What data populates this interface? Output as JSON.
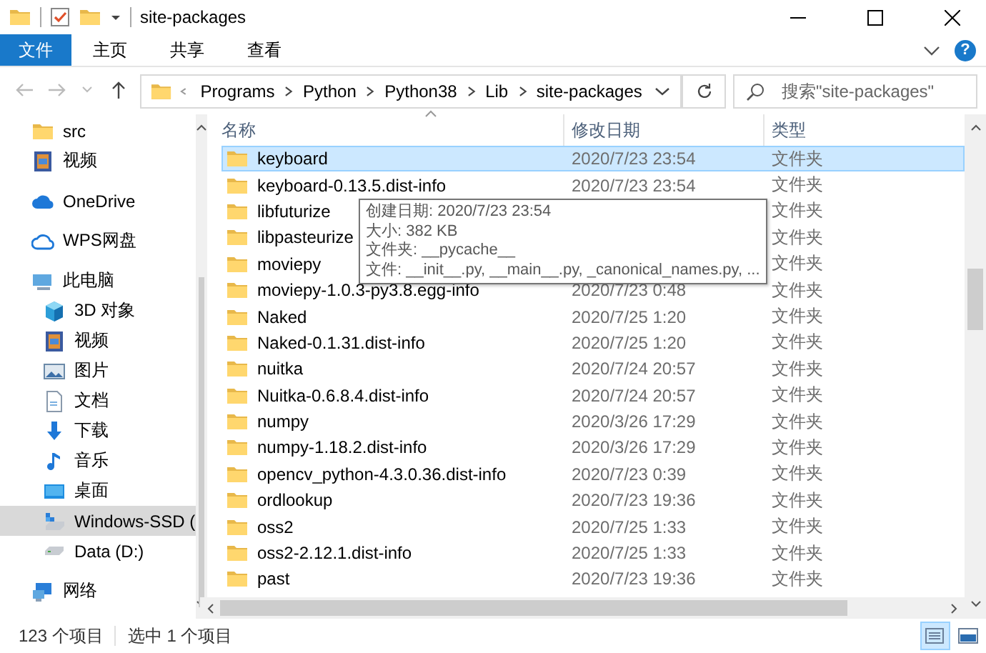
{
  "window": {
    "title": "site-packages"
  },
  "ribbon": {
    "file_button": "文件",
    "tabs": [
      {
        "label": "主页"
      },
      {
        "label": "共享"
      },
      {
        "label": "查看"
      }
    ],
    "help": "?"
  },
  "address": {
    "crumbs": [
      "Programs",
      "Python",
      "Python38",
      "Lib",
      "site-packages"
    ]
  },
  "search": {
    "placeholder": "搜索\"site-packages\""
  },
  "nav": {
    "items": [
      {
        "label": "src",
        "kind": "folder",
        "selected": false
      },
      {
        "label": "视频",
        "kind": "video",
        "selected": false
      },
      {
        "label": "OneDrive",
        "kind": "cloud",
        "selected": false
      },
      {
        "label": "WPS网盘",
        "kind": "cloud-outline",
        "selected": false
      },
      {
        "label": "此电脑",
        "kind": "pc",
        "selected": false,
        "children": [
          {
            "label": "3D 对象",
            "kind": "cube",
            "selected": false
          },
          {
            "label": "视频",
            "kind": "video",
            "selected": false
          },
          {
            "label": "图片",
            "kind": "picture",
            "selected": false
          },
          {
            "label": "文档",
            "kind": "document",
            "selected": false
          },
          {
            "label": "下载",
            "kind": "download",
            "selected": false
          },
          {
            "label": "音乐",
            "kind": "music",
            "selected": false
          },
          {
            "label": "桌面",
            "kind": "desktop",
            "selected": false
          },
          {
            "label": "Windows-SSD (",
            "kind": "system-drive",
            "selected": true
          },
          {
            "label": "Data (D:)",
            "kind": "drive",
            "selected": false
          }
        ]
      },
      {
        "label": "网络",
        "kind": "network",
        "selected": false
      }
    ]
  },
  "files": {
    "columns": [
      "名称",
      "修改日期",
      "类型"
    ],
    "rows": [
      {
        "name": "keyboard",
        "modified": "2020/7/23 23:54",
        "type": "文件夹",
        "selected": true
      },
      {
        "name": "keyboard-0.13.5.dist-info",
        "modified": "2020/7/23 23:54",
        "type": "文件夹",
        "selected": false
      },
      {
        "name": "libfuturize",
        "type": "文件夹",
        "selected": false
      },
      {
        "name": "libpasteurize",
        "type": "文件夹",
        "selected": false
      },
      {
        "name": "moviepy",
        "type": "文件夹",
        "selected": false
      },
      {
        "name": "moviepy-1.0.3-py3.8.egg-info",
        "modified": "2020/7/23 0:48",
        "type": "文件夹",
        "selected": false
      },
      {
        "name": "Naked",
        "modified": "2020/7/25 1:20",
        "type": "文件夹",
        "selected": false
      },
      {
        "name": "Naked-0.1.31.dist-info",
        "modified": "2020/7/25 1:20",
        "type": "文件夹",
        "selected": false
      },
      {
        "name": "nuitka",
        "modified": "2020/7/24 20:57",
        "type": "文件夹",
        "selected": false
      },
      {
        "name": "Nuitka-0.6.8.4.dist-info",
        "modified": "2020/7/24 20:57",
        "type": "文件夹",
        "selected": false
      },
      {
        "name": "numpy",
        "modified": "2020/3/26 17:29",
        "type": "文件夹",
        "selected": false
      },
      {
        "name": "numpy-1.18.2.dist-info",
        "modified": "2020/3/26 17:29",
        "type": "文件夹",
        "selected": false
      },
      {
        "name": "opencv_python-4.3.0.36.dist-info",
        "modified": "2020/7/23 0:39",
        "type": "文件夹",
        "selected": false
      },
      {
        "name": "ordlookup",
        "modified": "2020/7/23 19:36",
        "type": "文件夹",
        "selected": false
      },
      {
        "name": "oss2",
        "modified": "2020/7/25 1:33",
        "type": "文件夹",
        "selected": false
      },
      {
        "name": "oss2-2.12.1.dist-info",
        "modified": "2020/7/25 1:33",
        "type": "文件夹",
        "selected": false
      },
      {
        "name": "past",
        "modified": "2020/7/23 19:36",
        "type": "文件夹",
        "selected": false
      }
    ]
  },
  "tooltip": {
    "lines": [
      "创建日期: 2020/7/23 23:54",
      "大小: 382 KB",
      "文件夹: __pycache__",
      "文件: __init__.py, __main__.py, _canonical_names.py, ..."
    ]
  },
  "status_bar": {
    "item_count": "123 个项目",
    "selection": "选中 1 个项目"
  },
  "view_buttons": [
    {
      "kind": "details",
      "selected": true
    },
    {
      "kind": "large-icons",
      "selected": false
    }
  ]
}
